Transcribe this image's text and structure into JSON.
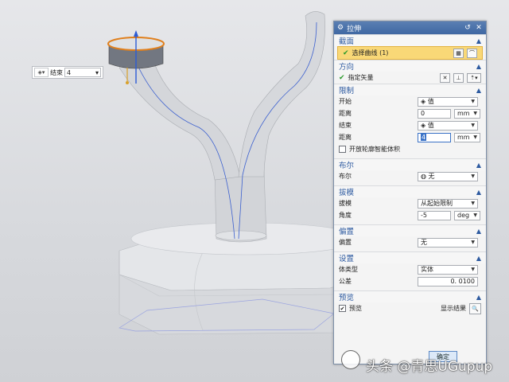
{
  "dialog": {
    "title": "拉伸",
    "sections": {
      "section": {
        "head": "截面",
        "select_curve": "选择曲线 (1)"
      },
      "direction": {
        "head": "方向",
        "specify_vector": "指定矢量"
      },
      "limits": {
        "head": "限制",
        "start_label": "开始",
        "start_value": "值",
        "dist1_label": "距离",
        "dist1_value": "0",
        "dist1_unit": "mm",
        "end_label": "结束",
        "end_value": "值",
        "dist2_label": "距离",
        "dist2_value": "4",
        "dist2_unit": "mm",
        "open_profile": "开放轮廓智能体积"
      },
      "boolean": {
        "head": "布尔",
        "label": "布尔",
        "value": "无"
      },
      "draft": {
        "head": "拔模",
        "draft_label": "拔模",
        "draft_value": "从起始限制",
        "angle_label": "角度",
        "angle_value": "-5",
        "angle_unit": "deg"
      },
      "offset": {
        "head": "偏置",
        "label": "偏置",
        "value": "无"
      },
      "settings": {
        "head": "设置",
        "body_type_label": "体类型",
        "body_type_value": "实体",
        "tolerance_label": "公差",
        "tolerance_value": "0. 0100"
      },
      "preview": {
        "head": "预览",
        "preview_label": "预览",
        "show_result": "显示结果"
      }
    },
    "ok": "确定"
  },
  "float_bar": {
    "label": "结束",
    "value": "4"
  },
  "watermark": "头条 @青思UGupup",
  "colors": {
    "title_bar": "#4a73ad",
    "section_head": "#2d5aa0",
    "highlight": "#f9d877",
    "model": "#d6d8dc"
  }
}
